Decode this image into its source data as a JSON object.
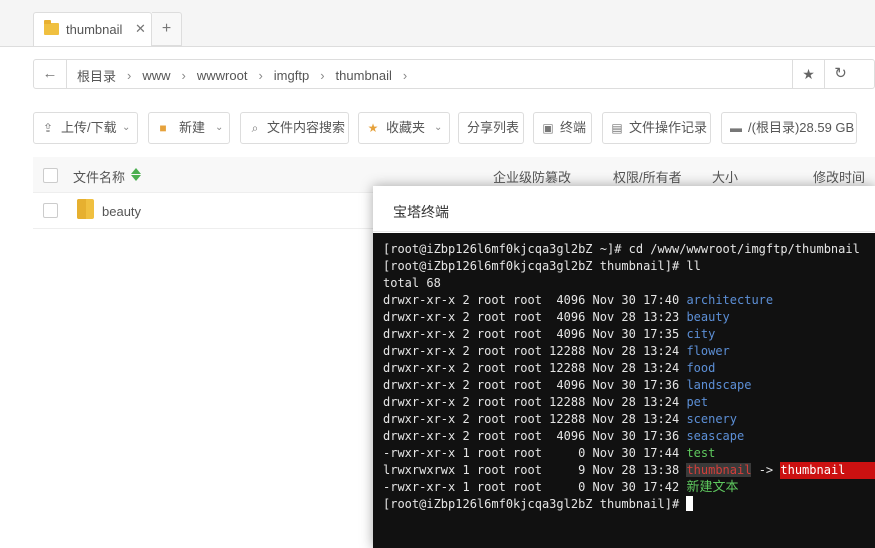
{
  "tab": {
    "title": "thumbnail",
    "close": "✕",
    "add": "+"
  },
  "address": {
    "crumbs": [
      "根目录",
      "www",
      "wwwroot",
      "imgftp",
      "thumbnail"
    ],
    "separator": "›"
  },
  "toolbar": {
    "upload": "上传/下载",
    "new": "新建",
    "search_content": "文件内容搜索",
    "favorites": "收藏夹",
    "share_list": "分享列表",
    "terminal": "终端",
    "operation_log": "文件操作记录",
    "disk": "/(根目录)28.59 GB"
  },
  "table": {
    "headers": {
      "name": "文件名称",
      "protect": "企业级防篡改",
      "perm": "权限/所有者",
      "size": "大小",
      "mtime": "修改时间"
    },
    "rows": [
      {
        "name": "beauty"
      }
    ]
  },
  "terminal": {
    "title": "宝塔终端",
    "lines": [
      "[root@iZbp126l6mf0kjcqa3gl2bZ ~]# cd /www/wwwroot/imgftp/thumbnail",
      "[root@iZbp126l6mf0kjcqa3gl2bZ thumbnail]# ll",
      "total 68"
    ],
    "entries": [
      {
        "meta": "drwxr-xr-x 2 root root  4096 Nov 30 17:40 ",
        "name": "architecture",
        "kind": "dir"
      },
      {
        "meta": "drwxr-xr-x 2 root root  4096 Nov 28 13:23 ",
        "name": "beauty",
        "kind": "dir"
      },
      {
        "meta": "drwxr-xr-x 2 root root  4096 Nov 30 17:35 ",
        "name": "city",
        "kind": "dir"
      },
      {
        "meta": "drwxr-xr-x 2 root root 12288 Nov 28 13:24 ",
        "name": "flower",
        "kind": "dir"
      },
      {
        "meta": "drwxr-xr-x 2 root root 12288 Nov 28 13:24 ",
        "name": "food",
        "kind": "dir"
      },
      {
        "meta": "drwxr-xr-x 2 root root  4096 Nov 30 17:36 ",
        "name": "landscape",
        "kind": "dir"
      },
      {
        "meta": "drwxr-xr-x 2 root root 12288 Nov 28 13:24 ",
        "name": "pet",
        "kind": "dir"
      },
      {
        "meta": "drwxr-xr-x 2 root root 12288 Nov 28 13:24 ",
        "name": "scenery",
        "kind": "dir"
      },
      {
        "meta": "drwxr-xr-x 2 root root  4096 Nov 30 17:36 ",
        "name": "seascape",
        "kind": "dir"
      },
      {
        "meta": "-rwxr-xr-x 1 root root     0 Nov 30 17:44 ",
        "name": "test",
        "kind": "exec"
      },
      {
        "meta": "lrwxrwxrwx 1 root root     9 Nov 28 13:38 ",
        "name": "thumbnail",
        "kind": "link",
        "arrow": " -> ",
        "target": "thumbnail"
      },
      {
        "meta": "-rwxr-xr-x 1 root root     0 Nov 30 17:42 ",
        "name": "新建文本",
        "kind": "exec-cn"
      }
    ],
    "prompt": "[root@iZbp126l6mf0kjcqa3gl2bZ thumbnail]# "
  },
  "colors": {
    "dir": "#5c8fd6",
    "exec": "#5ec85e",
    "link_bg": "#cc1111",
    "terminal_bg": "#111111"
  }
}
